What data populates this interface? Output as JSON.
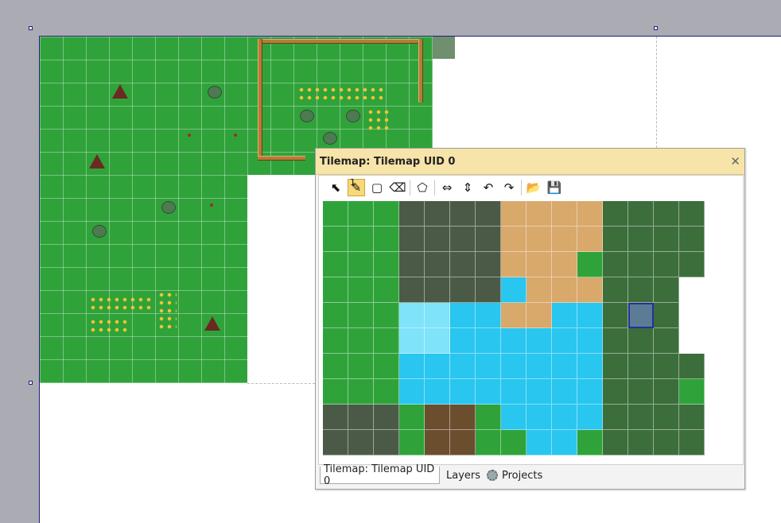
{
  "panel": {
    "title": "Tilemap: Tilemap UID 0",
    "close_glyph": "✕",
    "tile_index": "1"
  },
  "toolbar": {
    "tools": [
      {
        "name": "select-tool-icon",
        "glyph": "⬉"
      },
      {
        "name": "pencil-tool-icon",
        "glyph": "✎"
      },
      {
        "name": "rectangle-tool-icon",
        "glyph": "▢"
      },
      {
        "name": "eraser-tool-icon",
        "glyph": "⌫"
      },
      {
        "name": "polygon-tool-icon",
        "glyph": "⬠"
      },
      {
        "name": "move-horizontal-icon",
        "glyph": "⇔"
      },
      {
        "name": "move-vertical-icon",
        "glyph": "⇕"
      },
      {
        "name": "undo-icon",
        "glyph": "↶"
      },
      {
        "name": "redo-icon",
        "glyph": "↷"
      },
      {
        "name": "open-folder-icon",
        "glyph": "📂"
      },
      {
        "name": "save-icon",
        "glyph": "💾"
      }
    ]
  },
  "tabs": {
    "tilemap": "Tilemap: Tilemap UID 0",
    "layers": "Layers",
    "projects": "Projects"
  },
  "colors": {
    "grass": "#2fa33a",
    "selection": "#25319a",
    "header": "#f6e4a8"
  }
}
